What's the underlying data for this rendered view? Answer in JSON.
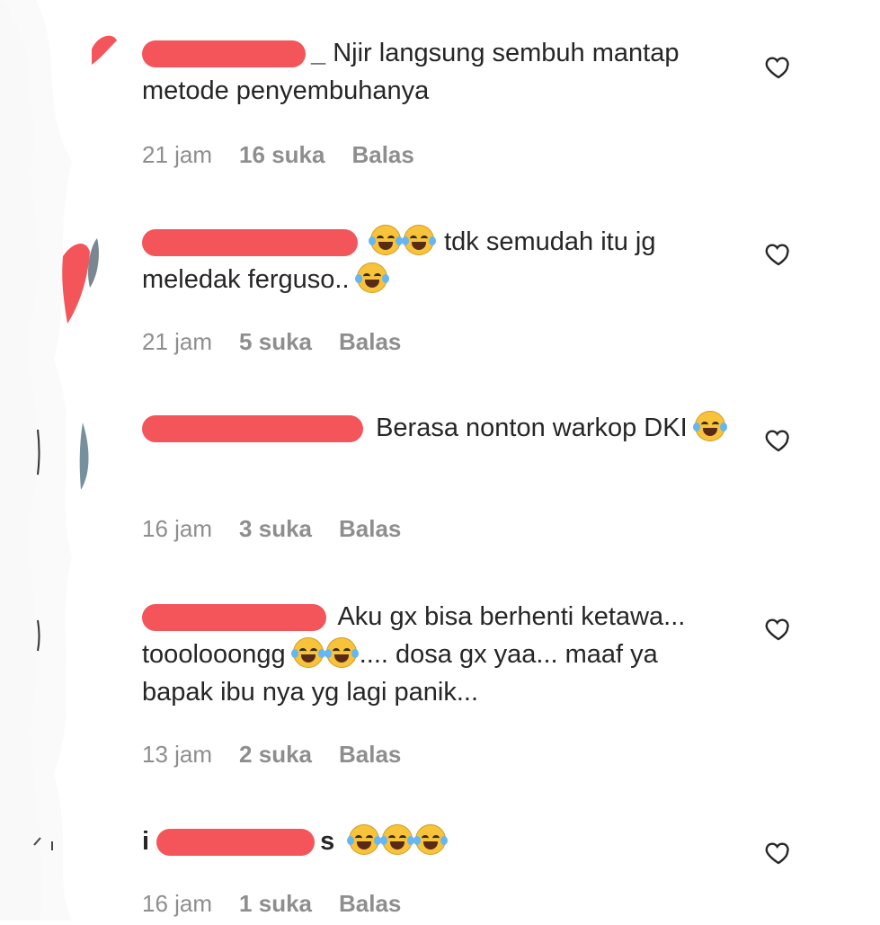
{
  "comments": [
    {
      "text": "Njir langsung sembuh mantap metode penyembuhanya",
      "emoji_count": 0,
      "time": "21 jam",
      "likes": "16 suka",
      "reply": "Balas"
    },
    {
      "text_before": "",
      "emoji_before": 2,
      "text": "tdk semudah itu jg meledak ferguso..",
      "emoji_after": 1,
      "time": "21 jam",
      "likes": "5 suka",
      "reply": "Balas"
    },
    {
      "text": "Berasa nonton warkop DKI",
      "emoji_after": 1,
      "time": "16 jam",
      "likes": "3 suka",
      "reply": "Balas"
    },
    {
      "text_part1": "Aku gx bisa berhenti ketawa... tooolooongg",
      "emoji_middle": 2,
      "text_part2": ".... dosa gx yaa... maaf ya bapak ibu nya yg lagi panik...",
      "time": "13 jam",
      "likes": "2 suka",
      "reply": "Balas"
    },
    {
      "text": "",
      "emoji_after": 3,
      "time": "16 jam",
      "likes": "1 suka",
      "reply": "Balas"
    }
  ],
  "icons": {
    "heart": "heart-icon",
    "laugh": "face-with-tears-of-joy-icon"
  },
  "colors": {
    "redaction": "#f3555a",
    "meta": "#8e8e8e",
    "text": "#262626"
  }
}
